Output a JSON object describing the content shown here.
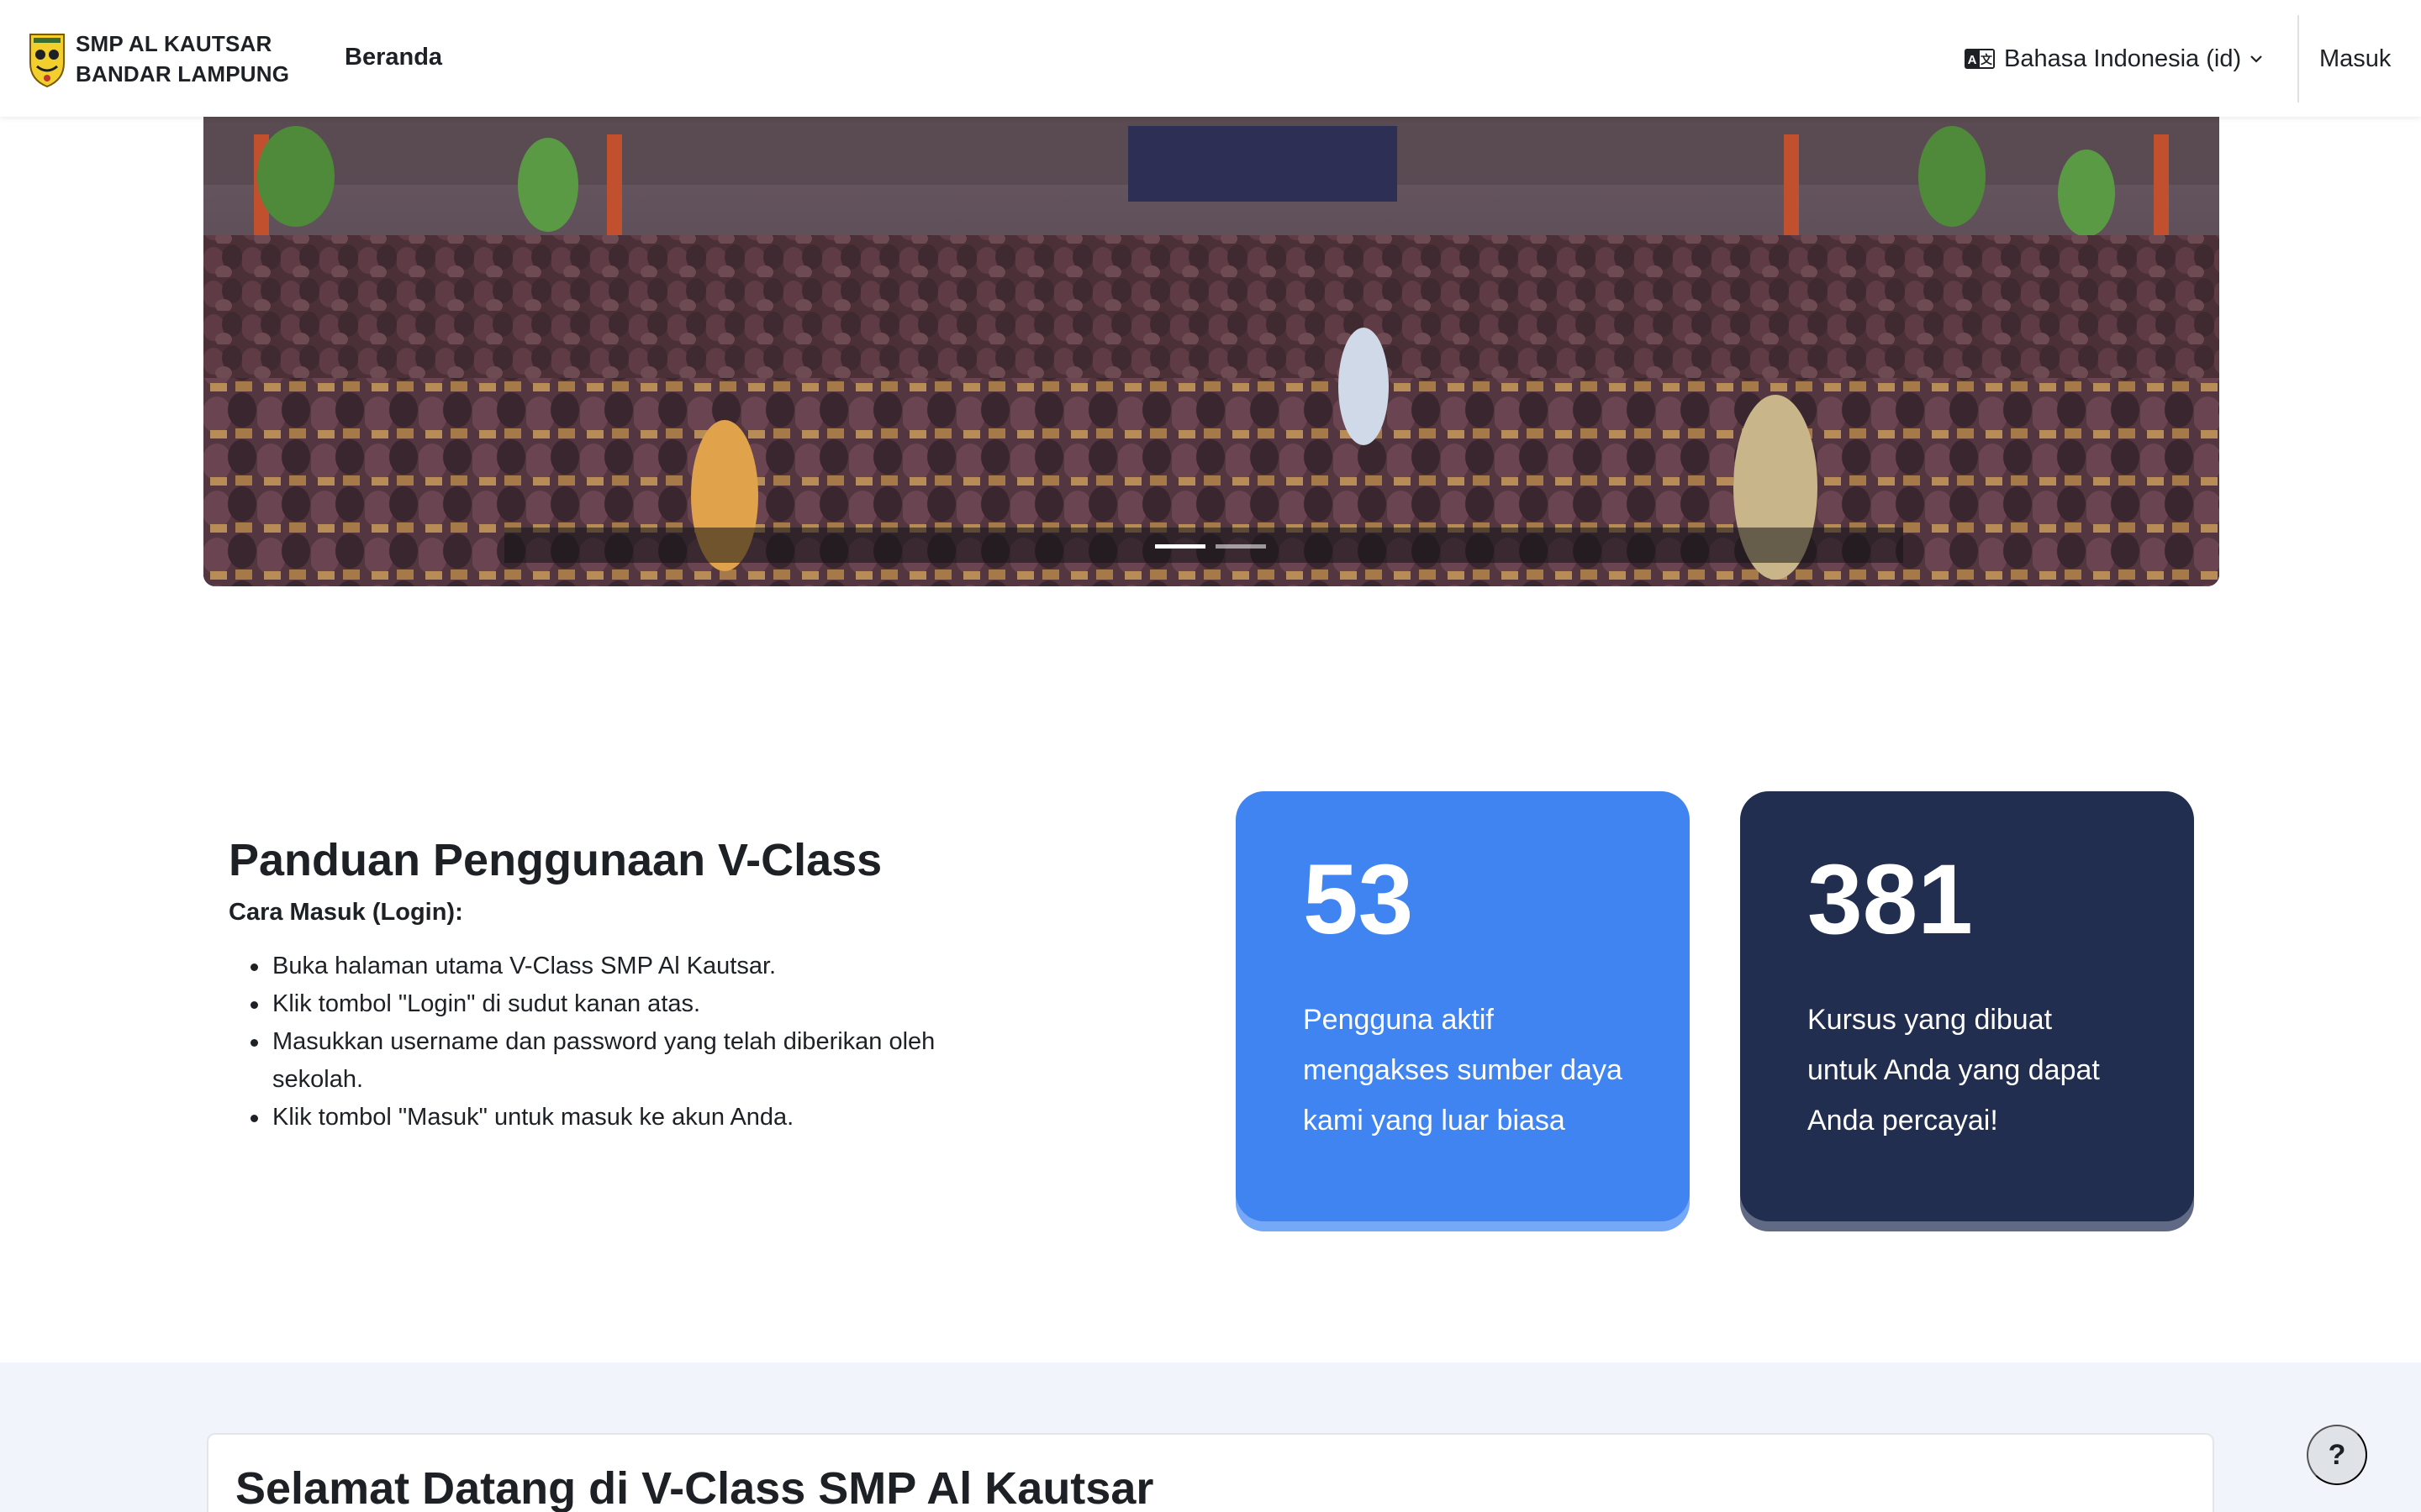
{
  "navbar": {
    "brand_line1": "SMP AL KAUTSAR",
    "brand_line2": "BANDAR LAMPUNG",
    "home_label": "Beranda",
    "language_label": "Bahasa Indonesia (id)",
    "login_label": "Masuk"
  },
  "carousel": {
    "slide_count": 2,
    "active_slide": 1
  },
  "guide": {
    "title": "Panduan Penggunaan V-Class",
    "subtitle": "Cara Masuk (Login):",
    "steps": [
      "Buka halaman utama V-Class SMP Al Kautsar.",
      "Klik tombol \"Login\" di sudut kanan atas.",
      "Masukkan username dan password yang telah diberikan oleh sekolah.",
      "Klik tombol \"Masuk\" untuk masuk ke akun Anda."
    ]
  },
  "stats": [
    {
      "value": "53",
      "description": "Pengguna aktif mengakses sumber daya kami yang luar biasa",
      "color": "#3f84f0"
    },
    {
      "value": "381",
      "description": "Kursus yang dibuat untuk Anda yang dapat Anda percayai!",
      "color": "#212e4f"
    }
  ],
  "welcome": {
    "title": "Selamat Datang di V-Class SMP Al Kautsar"
  },
  "help": {
    "label": "?"
  }
}
